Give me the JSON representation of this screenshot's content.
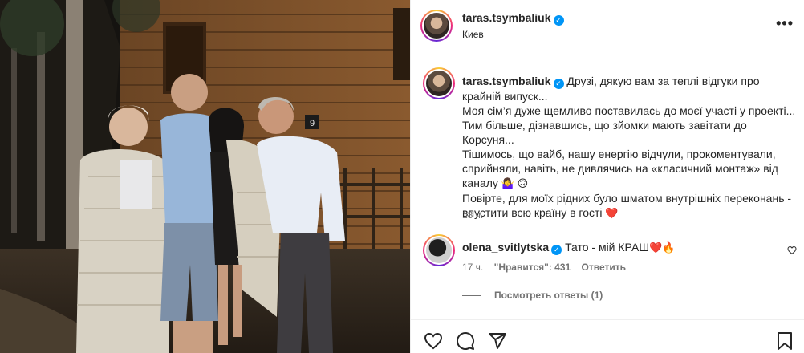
{
  "post": {
    "author": "taras.tsymbaliuk",
    "location": "Киев",
    "more_label": "•••",
    "verified_mark": "✓"
  },
  "caption": {
    "author": "taras.tsymbaliuk",
    "line1": "Друзі, дякую вам за теплі відгуки про крайній випуск...",
    "line2": "Моя сім’я дуже щемливо поставилась до моєї участі у проекті...",
    "line3": "Тим більше, дізнавшись, що зйомки мають завітати до Корсуня...",
    "line4": "Тішимось, що вайб, нашу енергію відчули, прокоментували, сприйняли, навіть, не дивлячись на «класичний монтаж» від каналу",
    "line4_emoji": "🤷‍♀️ 🙃",
    "line5": "Повірте, для моїх рідних було шматом внутрішніх переконань - впустити всю країну в гості",
    "line5_emoji": "❤️",
    "time": "18 ч."
  },
  "comment": {
    "author": "olena_svitlytska",
    "text": "Тато - мій КРАШ",
    "emoji": "❤️🔥",
    "time": "17 ч.",
    "likes": "\"Нравится\": 431",
    "reply": "Ответить"
  },
  "replies_label": "Посмотреть ответы (1)",
  "photo": {
    "sign_number": "9"
  },
  "icons": [
    "heart-icon",
    "comment-icon",
    "share-icon",
    "bookmark-icon",
    "more-icon",
    "verified-icon"
  ],
  "colors": {
    "verified": "#0095f6",
    "heart": "#ed4956",
    "muted": "#737373",
    "text": "#262626"
  }
}
